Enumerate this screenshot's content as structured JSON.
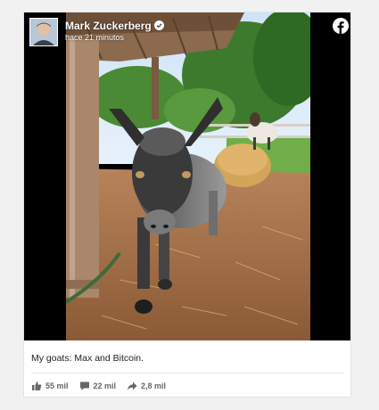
{
  "post": {
    "author": "Mark Zuckerberg",
    "time": "hace 21 minutos",
    "caption": "My goats: Max and Bitcoin.",
    "stats": {
      "likes": "55 mil",
      "comments": "22 mil",
      "shares": "2,8 mil"
    }
  },
  "icons": {
    "verified": "verified-check-icon",
    "brand": "facebook-logo-icon",
    "like": "thumbs-up-icon",
    "comment": "comment-icon",
    "share": "share-arrow-icon"
  },
  "colors": {
    "accent": "#1877f2",
    "text": "#1c1e21",
    "muted": "#65676b"
  }
}
